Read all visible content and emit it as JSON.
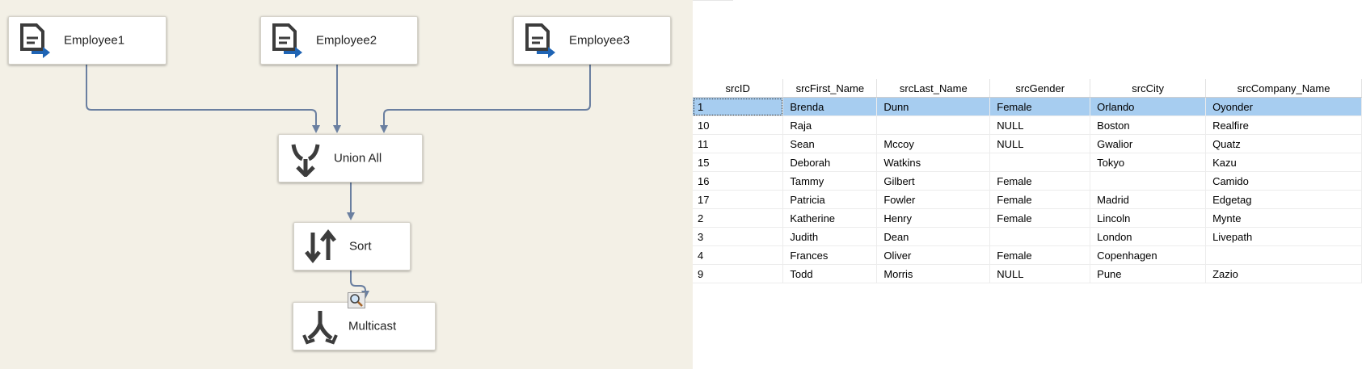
{
  "dataflow": {
    "nodes": [
      {
        "label": "Employee1",
        "icon": "ole-db-source-icon"
      },
      {
        "label": "Employee2",
        "icon": "ole-db-source-icon"
      },
      {
        "label": "Employee3",
        "icon": "ole-db-source-icon"
      },
      {
        "label": "Union All",
        "icon": "union-all-icon"
      },
      {
        "label": "Sort",
        "icon": "sort-icon"
      },
      {
        "label": "Multicast",
        "icon": "multicast-icon"
      }
    ],
    "data_viewer_icon": "magnifier-icon"
  },
  "grid": {
    "columns": [
      "srcID",
      "srcFirst_Name",
      "srcLast_Name",
      "srcGender",
      "srcCity",
      "srcCompany_Name"
    ],
    "rows": [
      [
        "1",
        "Brenda",
        "Dunn",
        "Female",
        "Orlando",
        "Oyonder"
      ],
      [
        "10",
        "Raja",
        "",
        "NULL",
        "Boston",
        "Realfire"
      ],
      [
        "11",
        "Sean",
        "Mccoy",
        "NULL",
        "Gwalior",
        "Quatz"
      ],
      [
        "15",
        "Deborah",
        "Watkins",
        "",
        "Tokyo",
        "Kazu"
      ],
      [
        "16",
        "Tammy",
        "Gilbert",
        "Female",
        "",
        "Camido"
      ],
      [
        "17",
        "Patricia",
        "Fowler",
        "Female",
        "Madrid",
        "Edgetag"
      ],
      [
        "2",
        "Katherine",
        "Henry",
        "Female",
        "Lincoln",
        "Mynte"
      ],
      [
        "3",
        "Judith",
        "Dean",
        "",
        "London",
        "Livepath"
      ],
      [
        "4",
        "Frances",
        "Oliver",
        "Female",
        "Copenhagen",
        ""
      ],
      [
        "9",
        "Todd",
        "Morris",
        "NULL",
        "Pune",
        "Zazio"
      ]
    ],
    "selected_row": 0,
    "selection_color": "#a7cdf0"
  },
  "colors": {
    "canvas": "#f3f0e6",
    "connector": "#6a7fa0",
    "icon_dark": "#3c3c3c",
    "icon_blue": "#1f64b4"
  }
}
